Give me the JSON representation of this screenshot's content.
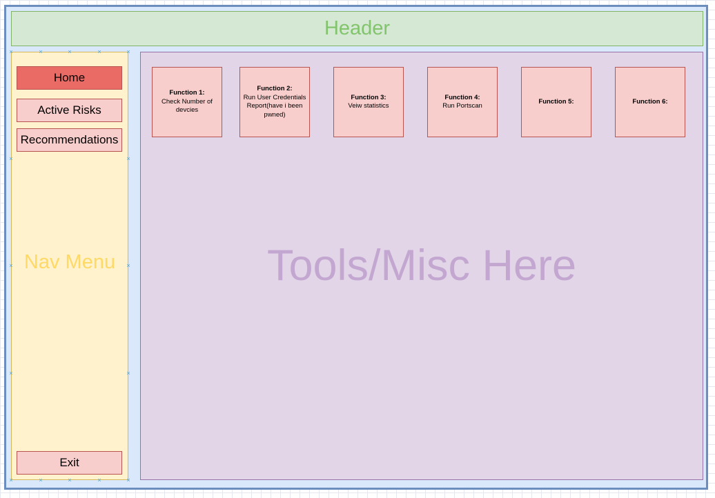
{
  "header": {
    "label": "Header"
  },
  "nav": {
    "label": "Nav Menu",
    "items": [
      {
        "label": "Home",
        "active": true
      },
      {
        "label": "Active Risks",
        "active": false
      },
      {
        "label": "Recommendations",
        "active": false
      }
    ],
    "exit_label": "Exit"
  },
  "main": {
    "label": "Tools/Misc Here",
    "functions": [
      {
        "title": "Function 1:",
        "desc": "Check Number of devcies"
      },
      {
        "title": "Function 2:",
        "desc": "Run User Credentials Report(have i been pwned)"
      },
      {
        "title": "Function 3:",
        "desc": "Veiw statistics"
      },
      {
        "title": "Function 4:",
        "desc": "Run Portscan"
      },
      {
        "title": "Function 5:",
        "desc": ""
      },
      {
        "title": "Function 6:",
        "desc": ""
      }
    ]
  },
  "colors": {
    "frame_fill": "#dae8fc",
    "frame_stroke": "#6c8ebf",
    "header_fill": "#d5e8d4",
    "header_text": "#82c46c",
    "nav_fill": "#fff2cc",
    "nav_text": "#ffd966",
    "button_fill": "#f8cecc",
    "button_active_fill": "#ea6b66",
    "button_stroke": "#b85450",
    "main_fill": "#e1d5e7",
    "main_text": "#c3a7d1"
  }
}
